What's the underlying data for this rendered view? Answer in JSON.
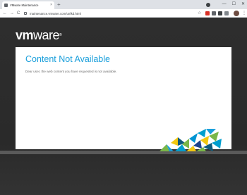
{
  "browser": {
    "tab_title": "VMware Maintenance",
    "tab_close": "×",
    "new_tab": "+",
    "url": "maintenance.vmware.com/unfkd.html",
    "win_minimize": "—",
    "win_maximize": "☐",
    "win_close": "✕",
    "back": "←",
    "forward": "→",
    "reload": "C",
    "star": "☆",
    "menu": "⋮"
  },
  "page": {
    "logo": "vm",
    "logo_light": "ware",
    "logo_mark": "®",
    "title": "Content Not Available",
    "message": "Dear user, the web content you have requested is not available."
  },
  "colors": {
    "accent": "#1a9fdb",
    "background": "#2b2b2b",
    "card": "#ffffff"
  }
}
